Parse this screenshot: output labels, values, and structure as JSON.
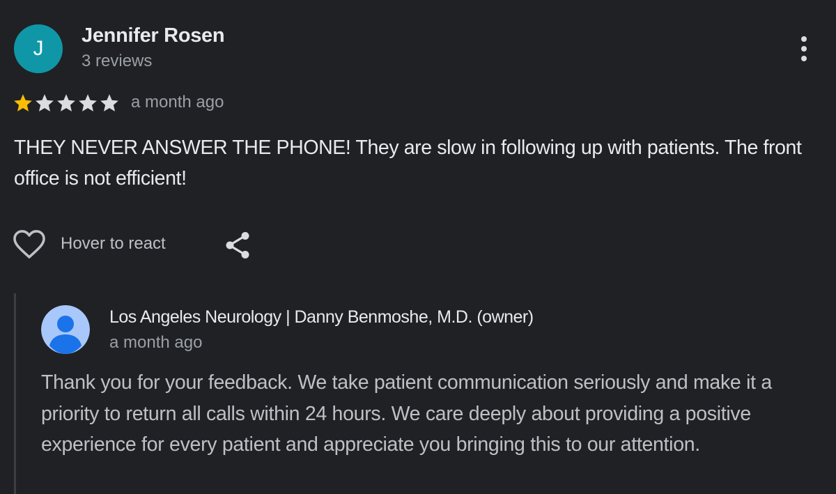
{
  "review": {
    "reviewer": {
      "initial": "J",
      "name": "Jennifer Rosen",
      "review_count": "3 reviews",
      "avatar_color": "#0f97a8"
    },
    "more_icon": "more-vert-icon",
    "rating": {
      "value": 1,
      "max": 5,
      "filled_color": "#fbbc04",
      "empty_color": "#dadce0"
    },
    "date": "a month ago",
    "text": "THEY NEVER ANSWER THE PHONE! They are slow in following up with patients. The front office is not efficient!",
    "actions": {
      "like_icon": "heart-outline-icon",
      "react_label": "Hover to react",
      "share_icon": "share-icon"
    }
  },
  "owner_reply": {
    "avatar_icon": "person-icon",
    "avatar_color": "#a8c7fa",
    "name": "Los Angeles Neurology | Danny Benmoshe, M.D. (owner)",
    "date": "a month ago",
    "text": "Thank you for your feedback. We take patient communication seriously and make it a priority to return all calls within 24 hours. We care deeply about providing a positive experience for every patient and appreciate you bringing this to our attention."
  }
}
